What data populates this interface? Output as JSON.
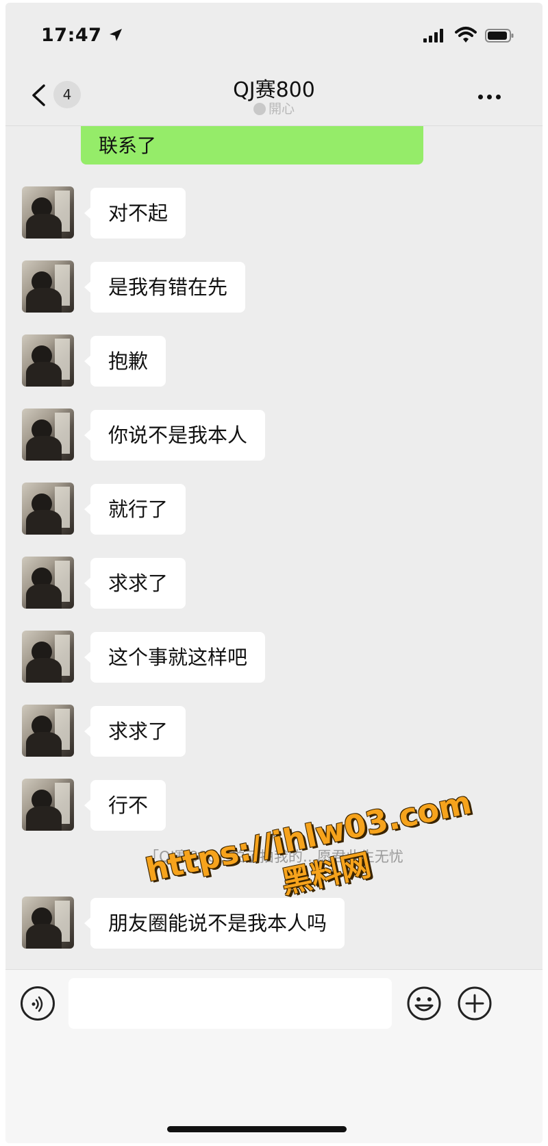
{
  "status_bar": {
    "time": "17:47"
  },
  "nav": {
    "back_count": "4",
    "title": "QJ赛800",
    "subtitle": "開心"
  },
  "chat": {
    "sent_partial": "联系了",
    "messages": [
      "对不起",
      "是我有错在先",
      "抱歉",
      "你说不是我本人",
      "就行了",
      "求求了",
      "这个事就这样吧",
      "求求了",
      "行不",
      "朋友圈能说不是我本人吗"
    ],
    "pat_notice": "「QJ赛800」拍了拍我的…愿君此生无忧"
  },
  "watermark": {
    "url": "https://ihlw03.com",
    "site": "黑料网"
  },
  "icons": {
    "location_arrow": "location-arrow-icon",
    "signal": "signal-icon",
    "wifi": "wifi-icon",
    "battery": "battery-icon",
    "back": "chevron-left-icon",
    "more": "more-icon",
    "voice": "voice-icon",
    "emoji": "emoji-icon",
    "plus": "plus-icon"
  },
  "colors": {
    "chat_bg": "#ededed",
    "sent_bubble": "#95ec69",
    "received_bubble": "#ffffff",
    "watermark": "#f6a31c"
  }
}
